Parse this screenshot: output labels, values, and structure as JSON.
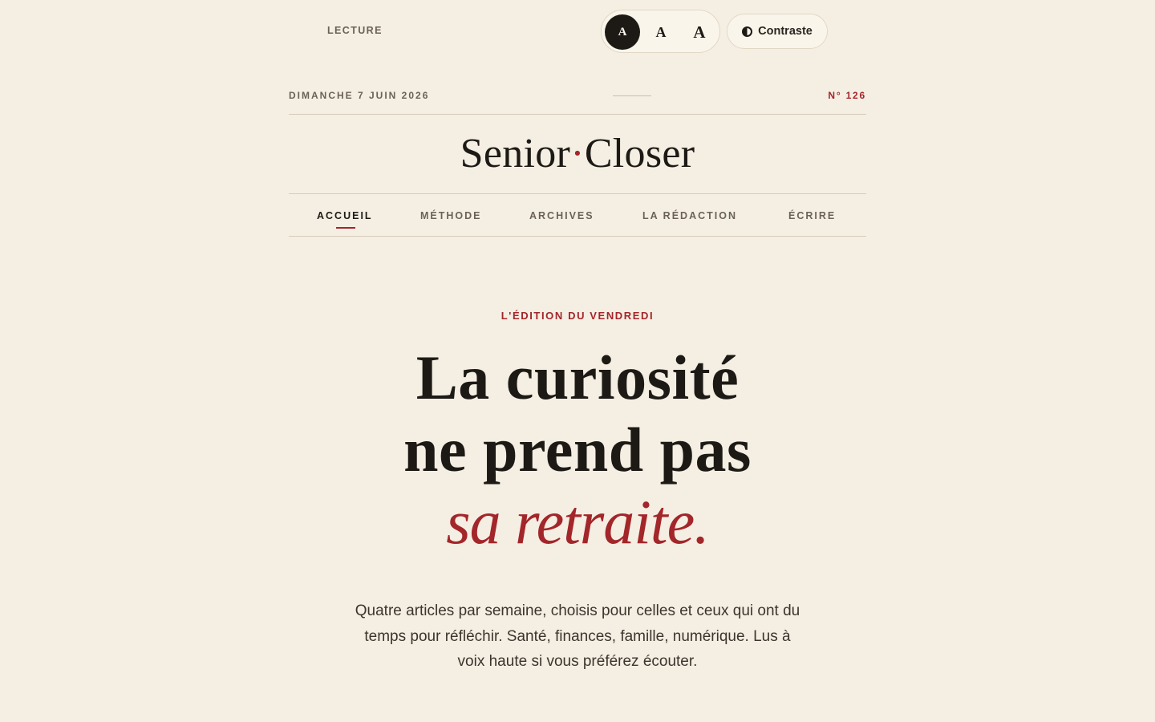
{
  "toolbar": {
    "label": "LECTURE",
    "font_sizes": [
      "A",
      "A",
      "A"
    ],
    "selected_size": 0,
    "contrast_label": "Contraste",
    "contrast_icon": "contrast-icon"
  },
  "masthead": {
    "date": "DIMANCHE 7 JUIN 2026",
    "issue": "N° 126",
    "brand_left": "Senior",
    "brand_dot": "·",
    "brand_right": "Closer"
  },
  "nav": {
    "items": [
      {
        "label": "ACCUEIL",
        "active": true
      },
      {
        "label": "MÉTHODE",
        "active": false
      },
      {
        "label": "ARCHIVES",
        "active": false
      },
      {
        "label": "LA RÉDACTION",
        "active": false
      },
      {
        "label": "ÉCRIRE",
        "active": false
      }
    ]
  },
  "hero": {
    "kicker": "L'ÉDITION DU VENDREDI",
    "headline_line1": "La curiosité",
    "headline_line2": "ne prend pas",
    "headline_accent": "sa retraite.",
    "lede": "Quatre articles par semaine, choisis pour celles et ceux qui ont du temps pour réfléchir. Santé, finances, famille, numérique. Lus à voix haute si vous préférez écouter."
  },
  "colors": {
    "background": "#f4eee3",
    "ink": "#1d1a16",
    "accent": "#a3262a",
    "muted": "#6b6255"
  }
}
